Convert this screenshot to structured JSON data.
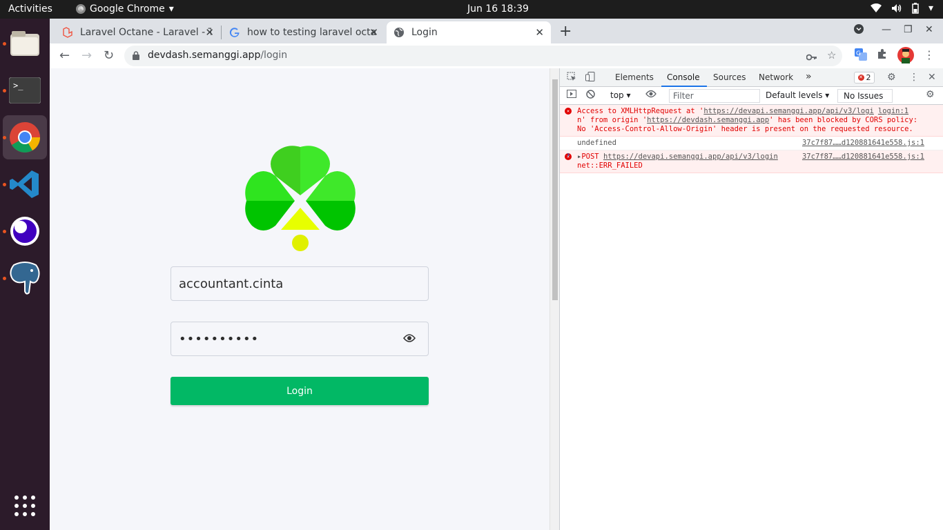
{
  "topbar": {
    "activities": "Activities",
    "app_name": "Google Chrome",
    "clock": "Jun 16  18:39"
  },
  "browser": {
    "tabs": [
      {
        "title": "Laravel Octane - Laravel - T"
      },
      {
        "title": "how to testing laravel octa"
      },
      {
        "title": "Login"
      }
    ],
    "new_tab": "+",
    "close": "✕",
    "url_host": "devdash.semanggi.app",
    "url_path": "/login"
  },
  "login": {
    "username": "accountant.cinta",
    "password_mask": "••••••••••",
    "button_label": "Login"
  },
  "devtools": {
    "tabs": [
      "Elements",
      "Console",
      "Sources",
      "Network"
    ],
    "more": "»",
    "error_count": "2",
    "context": "top",
    "filter_placeholder": "Filter",
    "levels": "Default levels",
    "issues": "No Issues",
    "messages": [
      {
        "type": "error",
        "text_pre": "Access to XMLHttpRequest at '",
        "link1": "https://devapi.semanggi.app/api/v3/logi",
        "src_inline": "login:1",
        "text_mid": "n' from origin '",
        "link2": "https://devdash.semanggi.app",
        "text_post": "' has been blocked by CORS policy: No 'Access-Control-Allow-Origin' header is present on the requested resource."
      },
      {
        "type": "log",
        "text": "undefined",
        "source": "37c7f87……d120881641e558.js:1"
      },
      {
        "type": "error",
        "method": "POST",
        "link": "https://devapi.semanggi.app/api/v3/login",
        "source": "37c7f87……d120881641e558.js:1",
        "detail": "net::ERR_FAILED"
      }
    ],
    "prompt": "›"
  },
  "colors": {
    "login_button": "#02b865",
    "console_error": "#e10000",
    "devtools_active_tab": "#1a73e8",
    "dock_indicator": "#e95420"
  }
}
